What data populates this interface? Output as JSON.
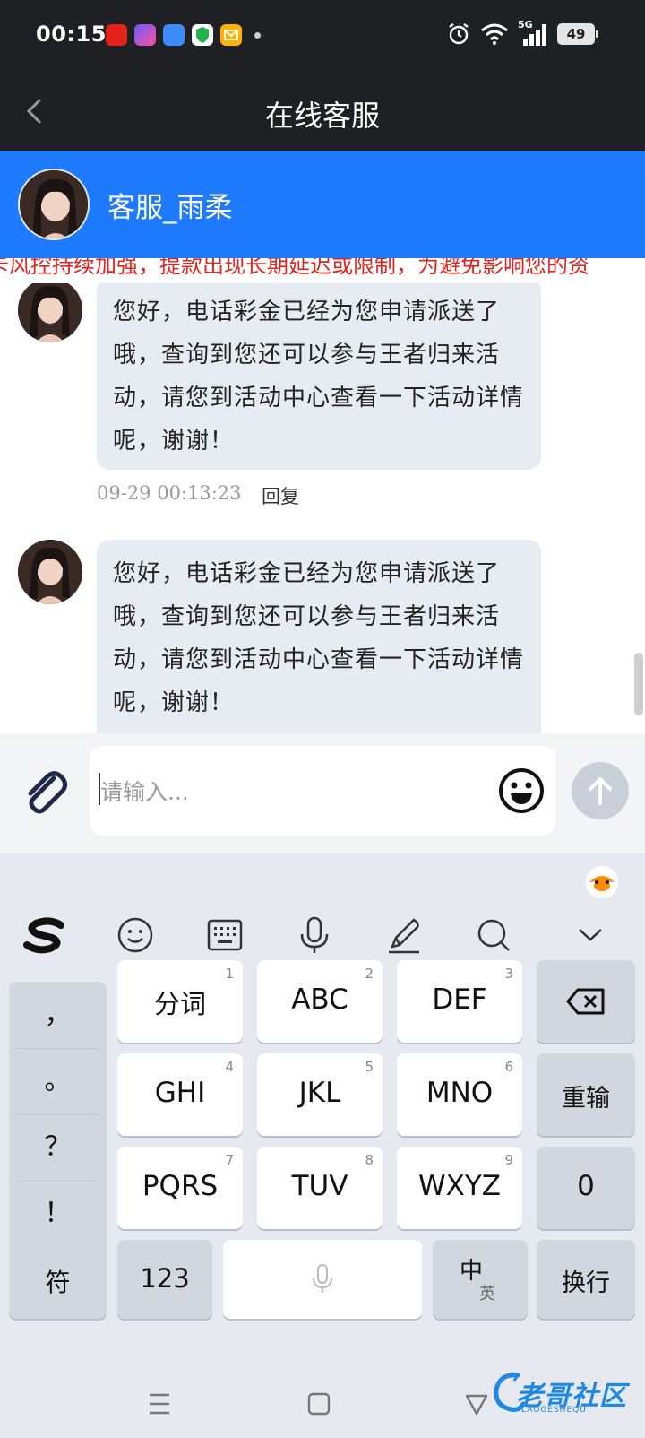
{
  "status_bar": {
    "time": "00:15",
    "network": "5G",
    "battery": "49",
    "app_icons": [
      "pinduoduo-icon",
      "vpn-icon",
      "cloud-icon",
      "shield-icon",
      "mail-icon"
    ]
  },
  "nav": {
    "title": "在线客服"
  },
  "agent": {
    "name": "客服_雨柔"
  },
  "marquee": {
    "text": "卡风控持续加强，提款出现长期延迟或限制，为避免影响您的资"
  },
  "messages": [
    {
      "text": "您好，电话彩金已经为您申请派送了哦，查询到您还可以参与王者归来活动，请您到活动中心查看一下活动详情呢，谢谢！",
      "time": "09-29 00:13:23",
      "reply_label": "回复"
    },
    {
      "text": "您好，电话彩金已经为您申请派送了哦，查询到您还可以参与王者归来活动，请您到活动中心查看一下活动详情呢，谢谢！"
    }
  ],
  "input": {
    "placeholder": "请输入..."
  },
  "keyboard": {
    "toolbar": [
      "sogou-logo-icon",
      "emoji-icon",
      "keyboard-icon",
      "microphone-icon",
      "handwriting-icon",
      "search-icon",
      "collapse-chevron-icon"
    ],
    "punctuation": [
      "，",
      "。",
      "？",
      "！"
    ],
    "keys_row1": [
      {
        "label": "分词",
        "num": "1"
      },
      {
        "label": "ABC",
        "num": "2"
      },
      {
        "label": "DEF",
        "num": "3"
      }
    ],
    "keys_row2": [
      {
        "label": "GHI",
        "num": "4"
      },
      {
        "label": "JKL",
        "num": "5"
      },
      {
        "label": "MNO",
        "num": "6"
      }
    ],
    "keys_row3": [
      {
        "label": "PQRS",
        "num": "7"
      },
      {
        "label": "TUV",
        "num": "8"
      },
      {
        "label": "WXYZ",
        "num": "9"
      }
    ],
    "retype": "重输",
    "zero": "0",
    "symbols": "符",
    "numbers": "123",
    "lang_main": "中",
    "lang_sub": "英",
    "enter": "换行"
  },
  "watermark": {
    "text": "老哥社区",
    "sub": "LAOGESHEQU"
  },
  "colors": {
    "header_blue": "#1e7bff",
    "dark_bar": "#1f2023",
    "bubble": "#e7ebf2",
    "marquee_red": "#e0241e"
  }
}
